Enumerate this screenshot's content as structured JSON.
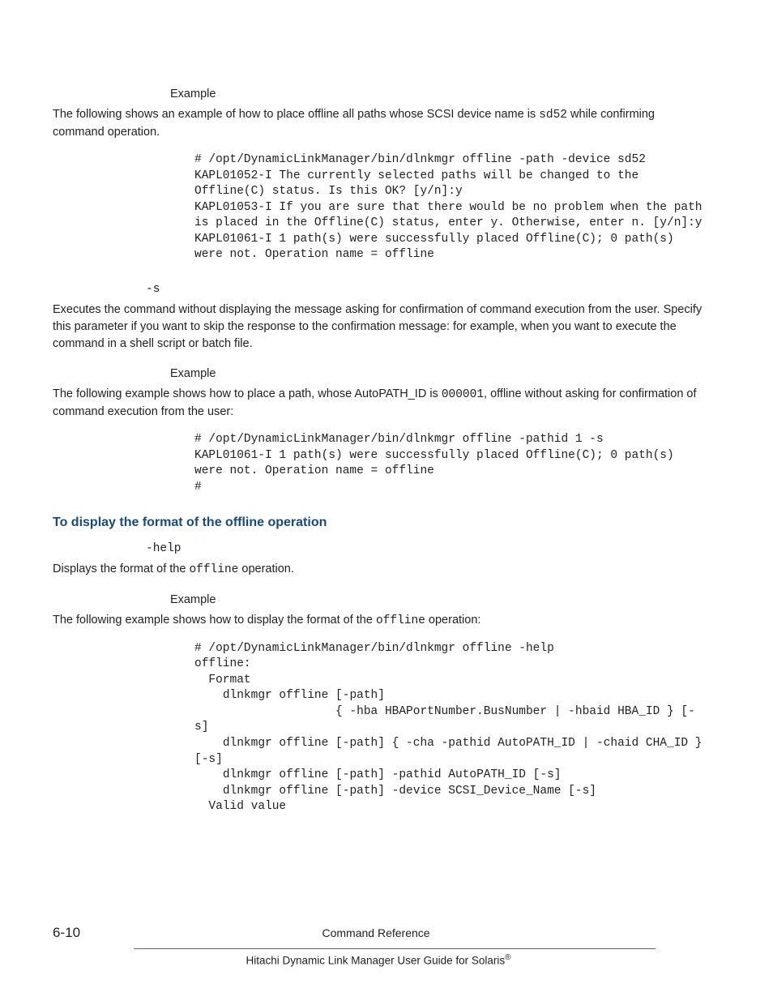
{
  "ex1": {
    "label": "Example",
    "intro_a": "The following shows an example of how to place offline all paths whose SCSI device name is ",
    "intro_code": "sd52",
    "intro_b": " while confirming command operation.",
    "code": "# /opt/DynamicLinkManager/bin/dlnkmgr offline -path -device sd52\nKAPL01052-I The currently selected paths will be changed to the Offline(C) status. Is this OK? [y/n]:y\nKAPL01053-I If you are sure that there would be no problem when the path is placed in the Offline(C) status, enter y. Otherwise, enter n. [y/n]:y\nKAPL01061-I 1 path(s) were successfully placed Offline(C); 0 path(s) were not. Operation name = offline"
  },
  "opt_s": {
    "flag": "-s",
    "desc": "Executes the command without displaying the message asking for confirmation of command execution from the user. Specify this parameter if you want to skip the response to the confirmation message: for example, when you want to execute the command in a shell script or batch file.",
    "ex_label": "Example",
    "ex_intro_a": "The following example shows how to place a path, whose AutoPATH_ID is ",
    "ex_intro_code": "000001",
    "ex_intro_b": ", offline without asking for confirmation of command execution from the user:",
    "code": "# /opt/DynamicLinkManager/bin/dlnkmgr offline -pathid 1 -s\nKAPL01061-I 1 path(s) were successfully placed Offline(C); 0 path(s) were not. Operation name = offline\n#"
  },
  "heading2": "To display the format of the offline operation",
  "help": {
    "flag": "-help",
    "desc_a": "Displays the format of the ",
    "desc_code": "offline",
    "desc_b": " operation.",
    "ex_label": "Example",
    "ex_intro_a": "The following example shows how to display the format of the ",
    "ex_intro_code": "offline",
    "ex_intro_b": " operation:",
    "code": "# /opt/DynamicLinkManager/bin/dlnkmgr offline -help\noffline:\n  Format\n    dlnkmgr offline [-path] \n                    { -hba HBAPortNumber.BusNumber | -hbaid HBA_ID } [-s]\n    dlnkmgr offline [-path] { -cha -pathid AutoPATH_ID | -chaid CHA_ID } [-s]\n    dlnkmgr offline [-path] -pathid AutoPATH_ID [-s]\n    dlnkmgr offline [-path] -device SCSI_Device_Name [-s]\n  Valid value"
  },
  "footer": {
    "pagenum": "6-10",
    "section": "Command Reference",
    "book_a": "Hitachi Dynamic Link Manager User Guide for Solaris",
    "book_reg": "®"
  }
}
